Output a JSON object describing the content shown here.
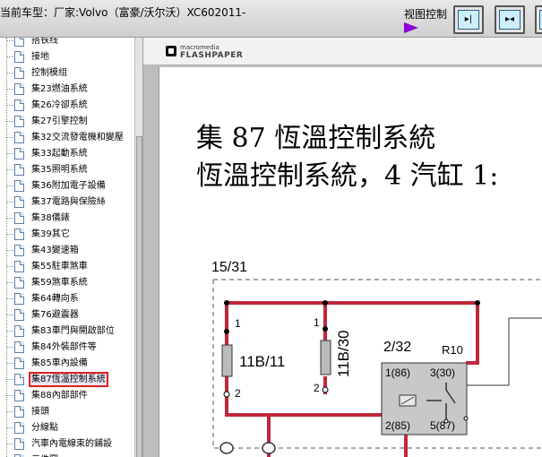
{
  "header": {
    "model_label": "当前车型：厂家:Volvo（富豪/沃尔沃）XC602011-",
    "view_control_label": "视图控制",
    "buttons": [
      {
        "glyph": "▸|"
      },
      {
        "glyph": "▸◂"
      },
      {
        "glyph": "|◂"
      }
    ]
  },
  "sidebar": {
    "items": [
      {
        "label": "搭铁线"
      },
      {
        "label": "接地"
      },
      {
        "label": "控制模组"
      },
      {
        "label": "集23燃油系統"
      },
      {
        "label": "集26冷卻系統"
      },
      {
        "label": "集27引擎控制"
      },
      {
        "label": "集32交流發電機和變壓"
      },
      {
        "label": "集33起動系統"
      },
      {
        "label": "集35照明系統"
      },
      {
        "label": "集36附加電子設備"
      },
      {
        "label": "集37電路與保險絲"
      },
      {
        "label": "集38儀錶"
      },
      {
        "label": "集39其它"
      },
      {
        "label": "集43變速箱"
      },
      {
        "label": "集55駐車煞車"
      },
      {
        "label": "集59煞車系統"
      },
      {
        "label": "集64轉向系"
      },
      {
        "label": "集76避震器"
      },
      {
        "label": "集83車門與開啟部位"
      },
      {
        "label": "集84外裝部件等"
      },
      {
        "label": "集85車內設備"
      },
      {
        "label": "集87恆溫控制系統",
        "selected": true
      },
      {
        "label": "集88內部部件"
      },
      {
        "label": "接頭"
      },
      {
        "label": "分線點"
      },
      {
        "label": "汽車內電線束的鋪設"
      },
      {
        "label": "元件圖"
      }
    ]
  },
  "viewer": {
    "logo_small": "macromedia",
    "logo_big": "FLASHPAPER"
  },
  "document": {
    "title": "集 87 恆溫控制系統",
    "subtitle": "恆溫控制系統，4 汽缸 1:"
  },
  "diagram": {
    "frame_label": "15/31",
    "fuse1_label": "11B/11",
    "fuse2_label": "11B/30",
    "relay_label": "2/32",
    "relay_name": "R10",
    "pin_1": "1",
    "pin_2": "2",
    "pin_1b": "1",
    "pin_2b": "2",
    "relay_pin_86": "1(86)",
    "relay_pin_30": "3(30)",
    "relay_pin_85": "2(85)",
    "relay_pin_87": "5(87)",
    "wire_color": "#c0283c"
  }
}
